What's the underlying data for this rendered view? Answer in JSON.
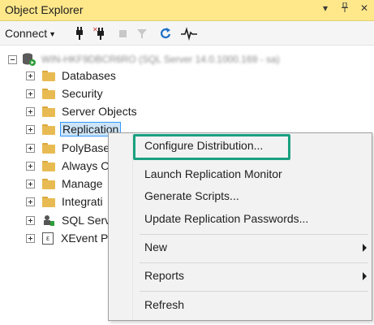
{
  "title_bar": {
    "title": "Object Explorer",
    "icons": [
      "dropdown-icon",
      "pin-icon",
      "close-icon"
    ]
  },
  "toolbar": {
    "connect_label": "Connect",
    "tools": [
      "connect-icon",
      "disconnect-icon",
      "stop-icon",
      "filter-icon",
      "refresh-icon",
      "activity-monitor-icon"
    ]
  },
  "tree": {
    "server_label": "WIN-HKF9DBCR6RO (SQL Server 14.0.1000.169 - sa)",
    "nodes": [
      {
        "label": "Databases",
        "icon": "folder-icon"
      },
      {
        "label": "Security",
        "icon": "folder-icon"
      },
      {
        "label": "Server Objects",
        "icon": "folder-icon"
      },
      {
        "label": "Replication",
        "icon": "folder-icon",
        "selected": true
      },
      {
        "label": "PolyBase",
        "icon": "folder-icon"
      },
      {
        "label": "Always O",
        "icon": "folder-icon"
      },
      {
        "label": "Manage",
        "icon": "folder-icon"
      },
      {
        "label": "Integrati",
        "icon": "folder-icon"
      },
      {
        "label": "SQL Serv",
        "icon": "sql-agent-icon"
      },
      {
        "label": "XEvent P",
        "icon": "xevent-icon"
      }
    ]
  },
  "context_menu": {
    "items": [
      {
        "label": "Configure Distribution...",
        "highlighted": true
      },
      {
        "label": "Launch Replication Monitor"
      },
      {
        "label": "Generate Scripts..."
      },
      {
        "label": "Update Replication Passwords..."
      },
      {
        "label": "New",
        "submenu": true
      },
      {
        "label": "Reports",
        "submenu": true
      },
      {
        "label": "Refresh"
      }
    ]
  },
  "colors": {
    "title_bar_bg": "#ffe88a",
    "highlight_border": "#1aa080",
    "selection_bg": "#cce4f7",
    "selection_border": "#3399ff"
  }
}
